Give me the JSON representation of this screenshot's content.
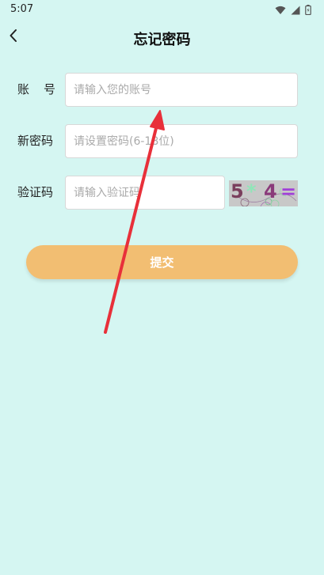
{
  "status_bar": {
    "time": "5:07",
    "icons": [
      "wifi-icon",
      "signal-icon",
      "battery-icon"
    ]
  },
  "header": {
    "title": "忘记密码",
    "back_icon": "chevron-left-icon"
  },
  "form": {
    "account": {
      "label_chars": [
        "账",
        "号"
      ],
      "placeholder": "请输入您的账号",
      "value": ""
    },
    "new_password": {
      "label": "新密码",
      "placeholder": "请设置密码(6-18位)",
      "value": ""
    },
    "verification": {
      "label": "验证码",
      "placeholder": "请输入验证码",
      "value": ""
    },
    "captcha": {
      "chars": [
        "5",
        "*",
        "4",
        "="
      ],
      "colors": [
        "#7a3e5c",
        "#8fe6b8",
        "#8a3a7a",
        "#a040d8"
      ]
    },
    "submit_label": "提交"
  },
  "colors": {
    "background": "#d5f6f2",
    "button": "#f2be72",
    "annotation_arrow": "#e8303a"
  }
}
